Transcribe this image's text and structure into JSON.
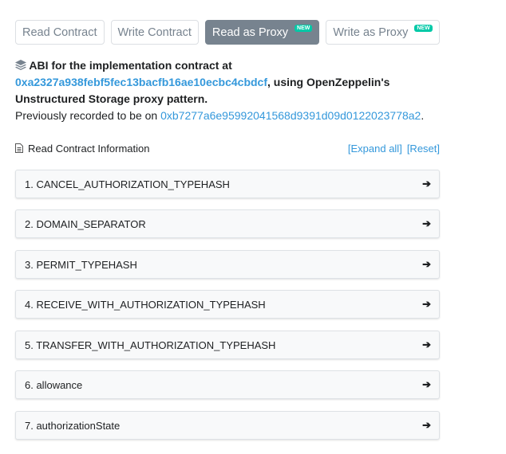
{
  "tabs": [
    {
      "label": "Read Contract",
      "badge": null
    },
    {
      "label": "Write Contract",
      "badge": null
    },
    {
      "label": "Read as Proxy",
      "badge": "NEW"
    },
    {
      "label": "Write as Proxy",
      "badge": "NEW"
    }
  ],
  "abi": {
    "prefix": "ABI for the implementation contract at",
    "address": "0xa2327a938febf5fec13bacfb16ae10ecbc4cbdcf",
    "suffix": ", using OpenZeppelin's Unstructured Storage proxy pattern.",
    "previous_label": "Previously recorded to be on",
    "previous_address": "0xb7277a6e95992041568d9391d09d0122023778a2",
    "period": "."
  },
  "info": {
    "title": "Read Contract Information",
    "expand_all": "[Expand all]",
    "reset": "[Reset]"
  },
  "functions": [
    "1. CANCEL_AUTHORIZATION_TYPEHASH",
    "2. DOMAIN_SEPARATOR",
    "3. PERMIT_TYPEHASH",
    "4. RECEIVE_WITH_AUTHORIZATION_TYPEHASH",
    "5. TRANSFER_WITH_AUTHORIZATION_TYPEHASH",
    "6. allowance",
    "7. authorizationState"
  ],
  "arrow_glyph": "➔"
}
